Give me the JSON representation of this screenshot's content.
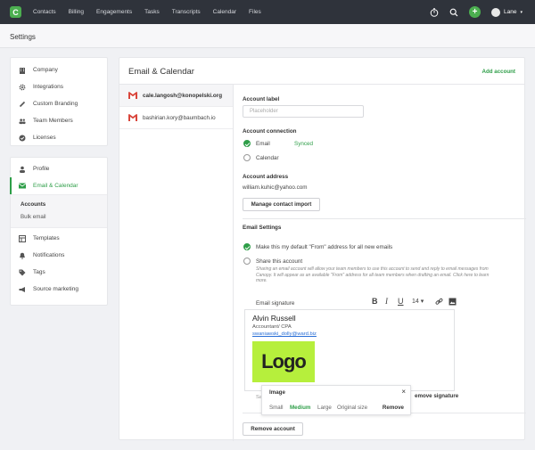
{
  "nav": {
    "logo_letter": "C",
    "items": [
      "Contacts",
      "Billing",
      "Engagements",
      "Tasks",
      "Transcripts",
      "Calendar",
      "Files"
    ],
    "user": "Lane",
    "add_symbol": "+"
  },
  "page": {
    "title": "Settings"
  },
  "sidebar": {
    "group1": [
      {
        "label": "Company",
        "icon": "building-icon"
      },
      {
        "label": "Integrations",
        "icon": "gear-icon"
      },
      {
        "label": "Custom Branding",
        "icon": "brush-icon"
      },
      {
        "label": "Team Members",
        "icon": "people-icon"
      },
      {
        "label": "Licenses",
        "icon": "badge-check-icon"
      }
    ],
    "group2": [
      {
        "label": "Profile",
        "icon": "person-icon"
      },
      {
        "label": "Email & Calendar",
        "icon": "envelope-icon",
        "active": true
      }
    ],
    "sub_items": [
      "Accounts",
      "Bulk email"
    ],
    "group3": [
      {
        "label": "Templates",
        "icon": "template-icon"
      },
      {
        "label": "Notifications",
        "icon": "bell-icon"
      },
      {
        "label": "Tags",
        "icon": "tag-icon"
      },
      {
        "label": "Source marketing",
        "icon": "megaphone-icon"
      }
    ]
  },
  "main": {
    "title": "Email & Calendar",
    "add_account": "Add account",
    "accounts": [
      "cale.langosh@konopelski.org",
      "bashirian.kory@baumbach.io"
    ],
    "account_label": "Account label",
    "account_label_placeholder": "Placeholder",
    "account_connection": "Account connection",
    "email": "Email",
    "synced": "Synced",
    "calendar": "Calendar",
    "account_address": "Account address",
    "address_value": "william.kuhic@yahoo.com",
    "manage_contact_import": "Manage contact import",
    "email_settings": "Email Settings",
    "default_from": "Make this my default \"From\" address for all new emails",
    "share_account": "Share this account",
    "share_hint": "Sharing an email account will allow your team members to use this account to send and reply to email messages from Canopy. It will appear as an available \"From\" address for all team members when drafting an email.  Click here to learn more.",
    "email_signature": "Email signature",
    "font_size": "14",
    "signature": {
      "name": "Alvin Russell",
      "role": "Accountant/ CPA",
      "email": "swaniawski_dolly@ward.biz",
      "logo_text": "Logo"
    },
    "sa_fragment": "Sa",
    "remove_signature": "emove signature",
    "remove_account": "Remove account"
  },
  "image_popup": {
    "title": "Image",
    "close": "×",
    "options": [
      "Small",
      "Medium",
      "Large",
      "Original size"
    ],
    "selected": "Medium",
    "remove": "Remove"
  }
}
